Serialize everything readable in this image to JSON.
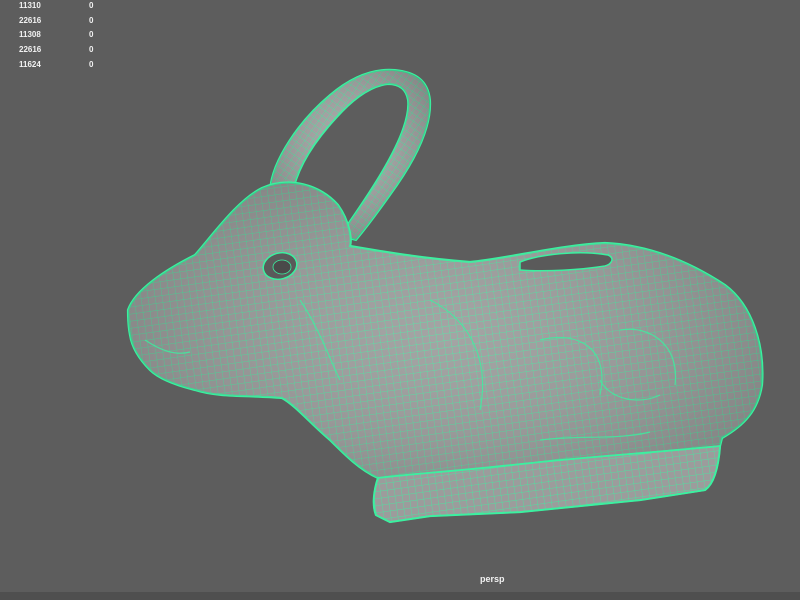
{
  "hud": {
    "rows": [
      {
        "count": "11310",
        "value": "0"
      },
      {
        "count": "22616",
        "value": "0"
      },
      {
        "count": "11308",
        "value": "0"
      },
      {
        "count": "22616",
        "value": "0"
      },
      {
        "count": "11624",
        "value": "0"
      }
    ]
  },
  "viewport": {
    "camera": "persp",
    "background_color": "#5d5d5d",
    "wireframe_color": "#3cf0a0",
    "mesh_color": "#9a9a9a",
    "model": "rabbit-mesh"
  }
}
